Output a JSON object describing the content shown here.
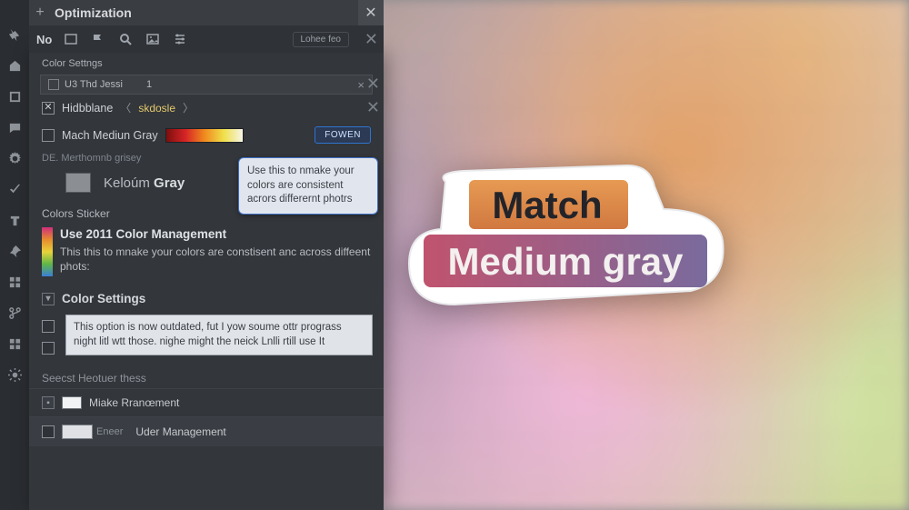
{
  "main_tab": {
    "title": "Optimization",
    "plus": "+"
  },
  "toolbar": {
    "logo": "No",
    "pill": "Lohee feo"
  },
  "panel": {
    "header": "Color Settngs",
    "subtab": {
      "label": "U3 Thd Jessi",
      "count": "1"
    },
    "row_hkb": {
      "label": "Hidbblane",
      "tag": "skdosle"
    },
    "row_mmg": {
      "label": "Mach Mediun Gray",
      "button": "FOWEN"
    },
    "dim_label": "DE.  Merthomnb grisey",
    "kelou": {
      "a": "Keloúm",
      "b": "Gray"
    },
    "tooltip": "Use this to nmake your colors are consistent acrors differernt photrs",
    "colors_sticker": "Colors Sticker",
    "cm_title": "Use 2011 Color Management",
    "cm_body": "This this to mnake your colors are constisent anc across diffeent phots:",
    "cs_head": "Color Settings",
    "cs_note": "This option is now outdated, fut I yow soume ottr prograss night litl wtt those. nighe might the neick Lnlli rtill use It",
    "sec2": "Seecst Heotuer thess",
    "mk": "Miake Rranœment",
    "enter": "Eneer",
    "uder": "Uder Management"
  },
  "sticker": {
    "line1": "Match",
    "line2": "Medium gray"
  }
}
